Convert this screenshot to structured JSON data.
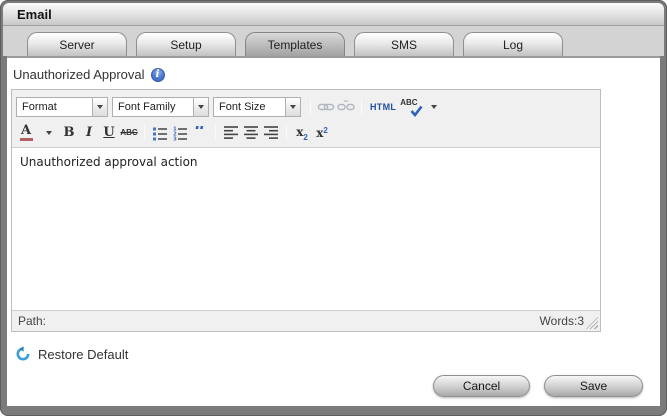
{
  "window": {
    "title": "Email"
  },
  "tabs": [
    {
      "label": "Server",
      "active": false
    },
    {
      "label": "Setup",
      "active": false
    },
    {
      "label": "Templates",
      "active": true
    },
    {
      "label": "SMS",
      "active": false
    },
    {
      "label": "Log",
      "active": false
    }
  ],
  "template_section": {
    "label": "Unauthorized Approval"
  },
  "editor": {
    "dropdowns": {
      "format": "Format",
      "font_family": "Font Family",
      "font_size": "Font Size"
    },
    "row1": {
      "html": "HTML",
      "spellcheck": "ABC"
    },
    "row2": {
      "forecolor": "A",
      "bold": "B",
      "italic": "I",
      "underline": "U",
      "strikethrough": "ABC",
      "blockquote": "“",
      "numbers": [
        "1",
        "2",
        "3"
      ],
      "sub_base": "x",
      "sub_mark": "2",
      "sup_base": "x",
      "sup_mark": "2"
    },
    "body_text": "Unauthorized approval action",
    "statusbar": {
      "path": "Path:",
      "words": "Words:3"
    }
  },
  "actions": {
    "restore_default": "Restore Default",
    "cancel": "Cancel",
    "save": "Save"
  },
  "icons": {
    "info": "info-icon",
    "link": "link-icon",
    "unlink": "unlink-icon",
    "html": "html-source-icon",
    "spellcheck": "spellcheck-icon",
    "forecolor": "font-color-icon",
    "bullet_list": "unordered-list-icon",
    "numbered_list": "ordered-list-icon",
    "blockquote": "blockquote-icon",
    "align_left": "align-left-icon",
    "align_center": "align-center-icon",
    "align_right": "align-right-icon",
    "subscript": "subscript-icon",
    "superscript": "superscript-icon",
    "resize": "resize-handle-icon",
    "restore": "restore-default-icon"
  },
  "colors": {
    "frame": "#7b7b7b",
    "tab_strip_bg": "#d3d3d3",
    "toolbar_bg": "#f0f0f0",
    "accent_blue": "#2f62b5",
    "disabled_icon": "#aab2be",
    "forecolor_bar": "#b06060"
  }
}
